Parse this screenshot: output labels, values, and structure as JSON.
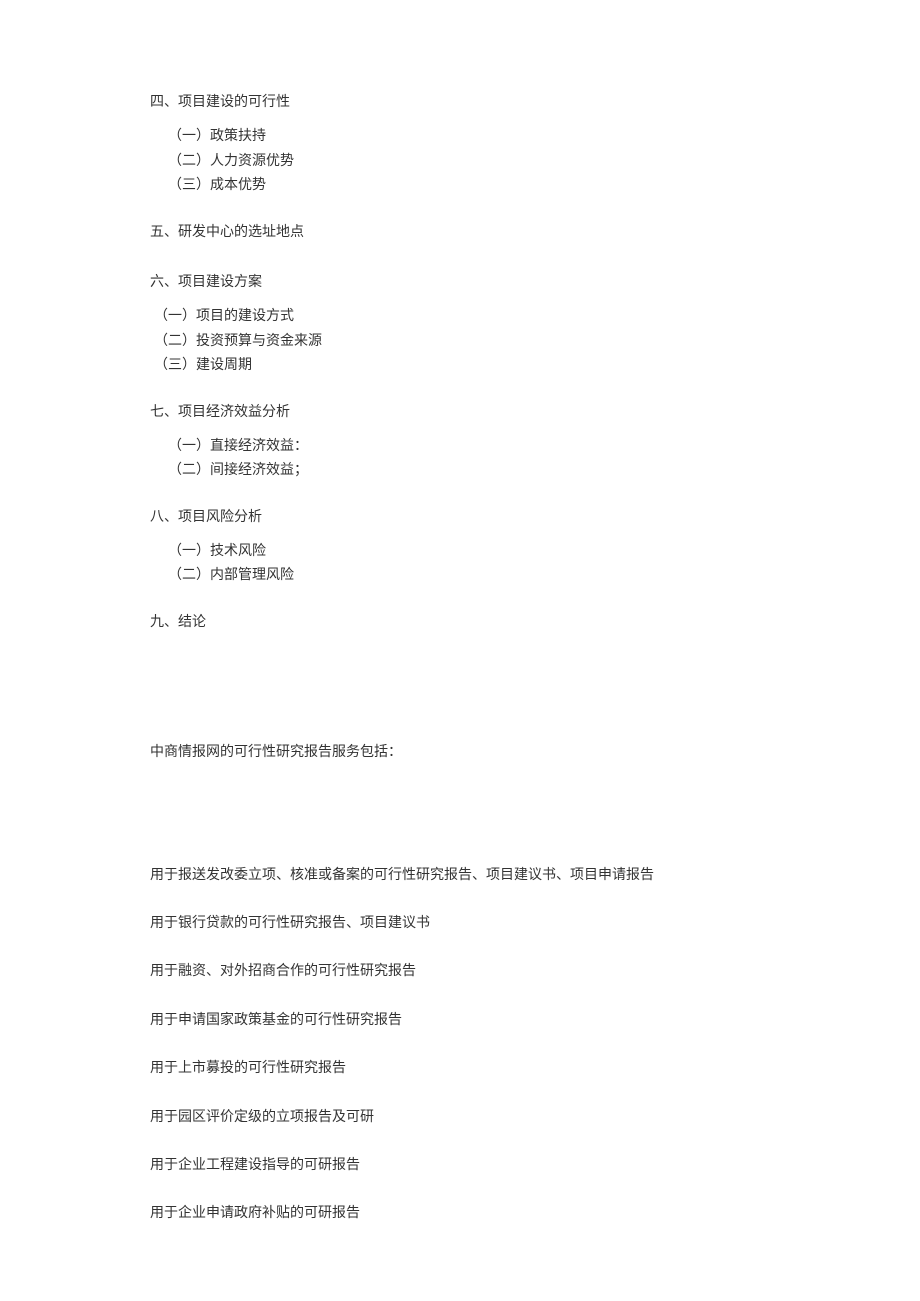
{
  "sections": {
    "s4": {
      "heading": "四、项目建设的可行性",
      "items": [
        "（一）政策扶持",
        "（二）人力资源优势",
        "（三）成本优势"
      ]
    },
    "s5": {
      "heading": "五、研发中心的选址地点"
    },
    "s6": {
      "heading": "六、项目建设方案",
      "items": [
        "（一）项目的建设方式",
        "（二）投资预算与资金来源",
        "（三）建设周期"
      ]
    },
    "s7": {
      "heading": "七、项目经济效益分析",
      "items": [
        "（一）直接经济效益：",
        "（二）间接经济效益；"
      ]
    },
    "s8": {
      "heading": "八、项目风险分析",
      "items": [
        "（一）技术风险",
        "（二）内部管理风险"
      ]
    },
    "s9": {
      "heading": "九、结论"
    }
  },
  "services": {
    "intro": "中商情报网的可行性研究报告服务包括：",
    "items": [
      "用于报送发改委立项、核准或备案的可行性研究报告、项目建议书、项目申请报告",
      "用于银行贷款的可行性研究报告、项目建议书",
      "用于融资、对外招商合作的可行性研究报告",
      "用于申请国家政策基金的可行性研究报告",
      "用于上市募投的可行性研究报告",
      "用于园区评价定级的立项报告及可研",
      "用于企业工程建设指导的可研报告",
      "用于企业申请政府补贴的可研报告"
    ]
  }
}
